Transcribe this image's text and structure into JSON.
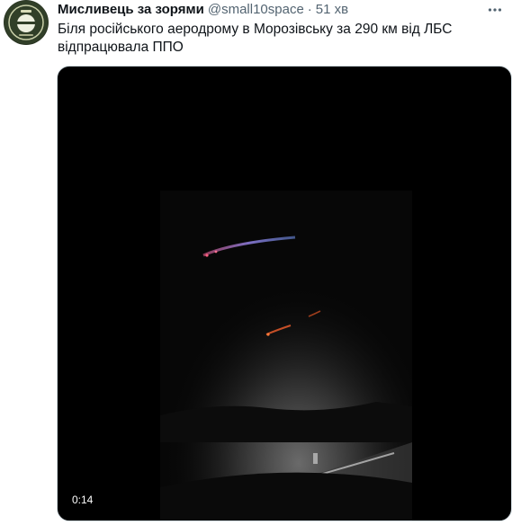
{
  "author": {
    "display_name": "Мисливець за зорями",
    "handle": "@small10space",
    "separator": "·",
    "timestamp": "51 хв"
  },
  "tweet": {
    "text_line1": "Біля російського аеродрому в Морозівську за 290 км від ЛБС",
    "text_line2": "відпрацювала ППО"
  },
  "media": {
    "duration": "0:14"
  },
  "icons": {
    "more": "more-horizontal-icon",
    "avatar": "avatar-emblem"
  },
  "colors": {
    "primary_text": "#0f1419",
    "secondary_text": "#536471",
    "media_border": "#cfd9de"
  }
}
